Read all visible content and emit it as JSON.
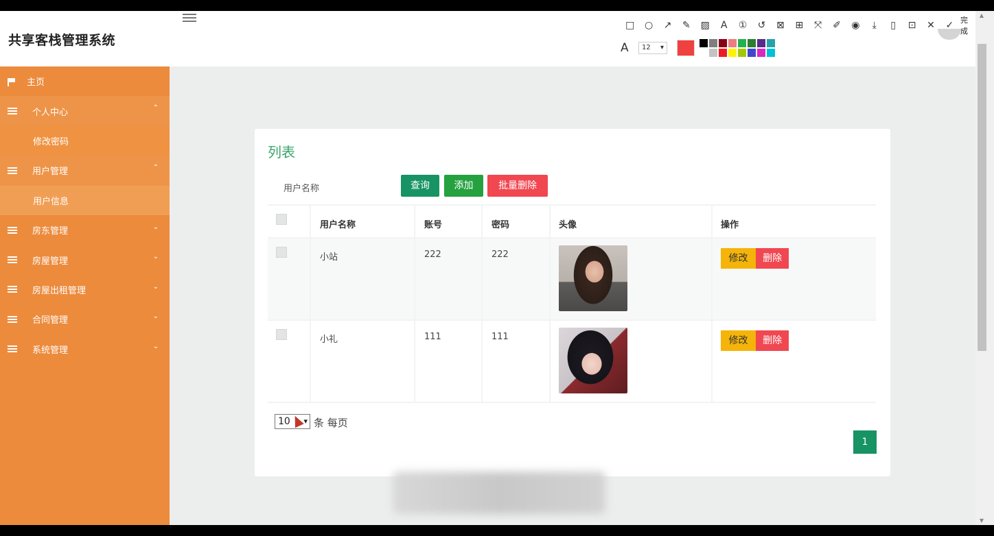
{
  "app": {
    "title": "共享客栈管理系统"
  },
  "screenshot_toolbar": {
    "tools": [
      "rect-icon",
      "circle-icon",
      "arrow-icon",
      "pen-icon",
      "mosaic-icon",
      "text-icon",
      "number-icon",
      "undo-icon",
      "pin-icon",
      "ocr-icon",
      "scroll-icon",
      "pencil-icon",
      "record-icon",
      "download-icon",
      "phone-icon",
      "save-icon",
      "close-icon",
      "check-icon"
    ],
    "done_label": "完成",
    "font_size": "12",
    "current_color": "#f04040",
    "palette": [
      "#000000",
      "#7f7f7f",
      "#880015",
      "#ed7e7e",
      "#22b14c",
      "#2e7d32",
      "#5a2b8a",
      "#27a2a8",
      "#ffffff",
      "#c3c3c3",
      "#ed1c24",
      "#fff200",
      "#a3c80a",
      "#3f48cc",
      "#d62bc0",
      "#00c0d8"
    ]
  },
  "sidebar": {
    "items": [
      {
        "label": "主页",
        "icon": "flag-icon"
      },
      {
        "label": "个人中心",
        "icon": "list-icon",
        "open": true,
        "children": [
          "修改密码"
        ]
      },
      {
        "label": "用户管理",
        "icon": "list-icon",
        "open": true,
        "children": [
          "用户信息"
        ]
      },
      {
        "label": "房东管理",
        "icon": "list-icon"
      },
      {
        "label": "房屋管理",
        "icon": "list-icon"
      },
      {
        "label": "房屋出租管理",
        "icon": "list-icon"
      },
      {
        "label": "合同管理",
        "icon": "list-icon"
      },
      {
        "label": "系统管理",
        "icon": "list-icon"
      }
    ]
  },
  "main": {
    "title": "列表",
    "search": {
      "label": "用户名称"
    },
    "buttons": {
      "query": "查询",
      "add": "添加",
      "batch_delete": "批量删除"
    },
    "table": {
      "columns": [
        "用户名称",
        "账号",
        "密码",
        "头像",
        "操作"
      ],
      "rows": [
        {
          "username": "小站",
          "account": "222",
          "password": "222"
        },
        {
          "username": "小礼",
          "account": "111",
          "password": "111"
        }
      ],
      "actions": {
        "edit": "修改",
        "delete": "删除"
      }
    },
    "pager": {
      "page_size": "10",
      "per_page_text": "条 每页",
      "current_page": "1"
    }
  }
}
